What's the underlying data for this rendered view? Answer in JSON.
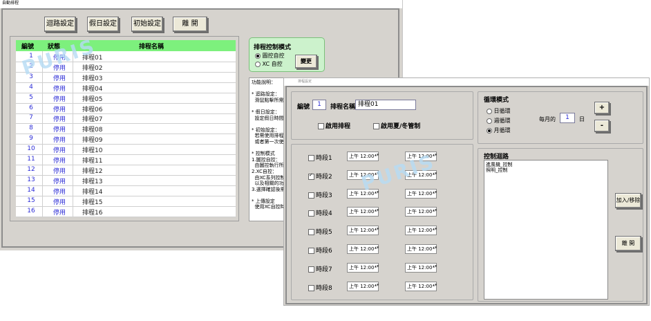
{
  "win1": {
    "title": "自動排程",
    "buttons": {
      "circuit": "迴路設定",
      "holiday": "假日設定",
      "init": "初始設定",
      "close": "離 開"
    },
    "list": {
      "headers": {
        "num": "編號",
        "status": "狀態",
        "name": "排程名稱"
      },
      "rows": [
        {
          "num": "1",
          "status": "停用",
          "name": "排程01"
        },
        {
          "num": "2",
          "status": "停用",
          "name": "排程02"
        },
        {
          "num": "3",
          "status": "停用",
          "name": "排程03"
        },
        {
          "num": "4",
          "status": "停用",
          "name": "排程04"
        },
        {
          "num": "5",
          "status": "停用",
          "name": "排程05"
        },
        {
          "num": "6",
          "status": "停用",
          "name": "排程06"
        },
        {
          "num": "7",
          "status": "停用",
          "name": "排程07"
        },
        {
          "num": "8",
          "status": "停用",
          "name": "排程08"
        },
        {
          "num": "9",
          "status": "停用",
          "name": "排程09"
        },
        {
          "num": "10",
          "status": "停用",
          "name": "排程10"
        },
        {
          "num": "11",
          "status": "停用",
          "name": "排程11"
        },
        {
          "num": "12",
          "status": "停用",
          "name": "排程12"
        },
        {
          "num": "13",
          "status": "停用",
          "name": "排程13"
        },
        {
          "num": "14",
          "status": "停用",
          "name": "排程14"
        },
        {
          "num": "15",
          "status": "停用",
          "name": "排程15"
        },
        {
          "num": "16",
          "status": "停用",
          "name": "排程16"
        }
      ]
    },
    "mode": {
      "title": "排程控制模式",
      "opt1": "圖控自控",
      "opt2": "XC 自控",
      "change_btn": "變更"
    },
    "desc": "功能說明：\n\n* 迴路設定：\n  滑鼠點擊所需\n\n* 假日設定：\n  設定假日時間\n\n* 初始設定：\n  若需使用排程\n  或者第一次使\n\n* 控制模式\n1.圖控自控：\n  由圖控執行所\n2.XC自控：\n  由XC系列控制\n  以及相關的功\n3.選擇確認後需\n\n* 上傳設定\n  使用XC自控時"
  },
  "win2": {
    "title": "排程設定",
    "num_label": "編號",
    "num_value": "1",
    "name_label": "排程名稱",
    "name_value": "排程01",
    "enable_label": "啟用排程",
    "dst_label": "啟用夏/冬管制",
    "segments": [
      {
        "label": "時段1",
        "start": "上午 12:00",
        "end": "上午 12:00"
      },
      {
        "label": "時段2",
        "start": "上午 12:00",
        "end": "上午 12:00"
      },
      {
        "label": "時段3",
        "start": "上午 12:00",
        "end": "上午 12:00"
      },
      {
        "label": "時段4",
        "start": "上午 12:00",
        "end": "上午 12:00"
      },
      {
        "label": "時段5",
        "start": "上午 12:00",
        "end": "上午 12:00"
      },
      {
        "label": "時段6",
        "start": "上午 12:00",
        "end": "上午 12:00"
      },
      {
        "label": "時段7",
        "start": "上午 12:00",
        "end": "上午 12:00"
      },
      {
        "label": "時段8",
        "start": "上午 12:00",
        "end": "上午 12:00"
      }
    ],
    "cycle": {
      "title": "循環模式",
      "daily": "日循環",
      "weekly": "週循環",
      "monthly": "月循環",
      "every_month_label": "每月的",
      "day_value": "1",
      "day_unit": "日",
      "plus": "+",
      "minus": "-"
    },
    "circuits": {
      "title": "控制迴路",
      "items": [
        "進風機_控制",
        "照明_控制"
      ]
    },
    "add_remove_btn": "加入/移除",
    "close_btn": "離 開"
  },
  "watermark": "PURIS"
}
